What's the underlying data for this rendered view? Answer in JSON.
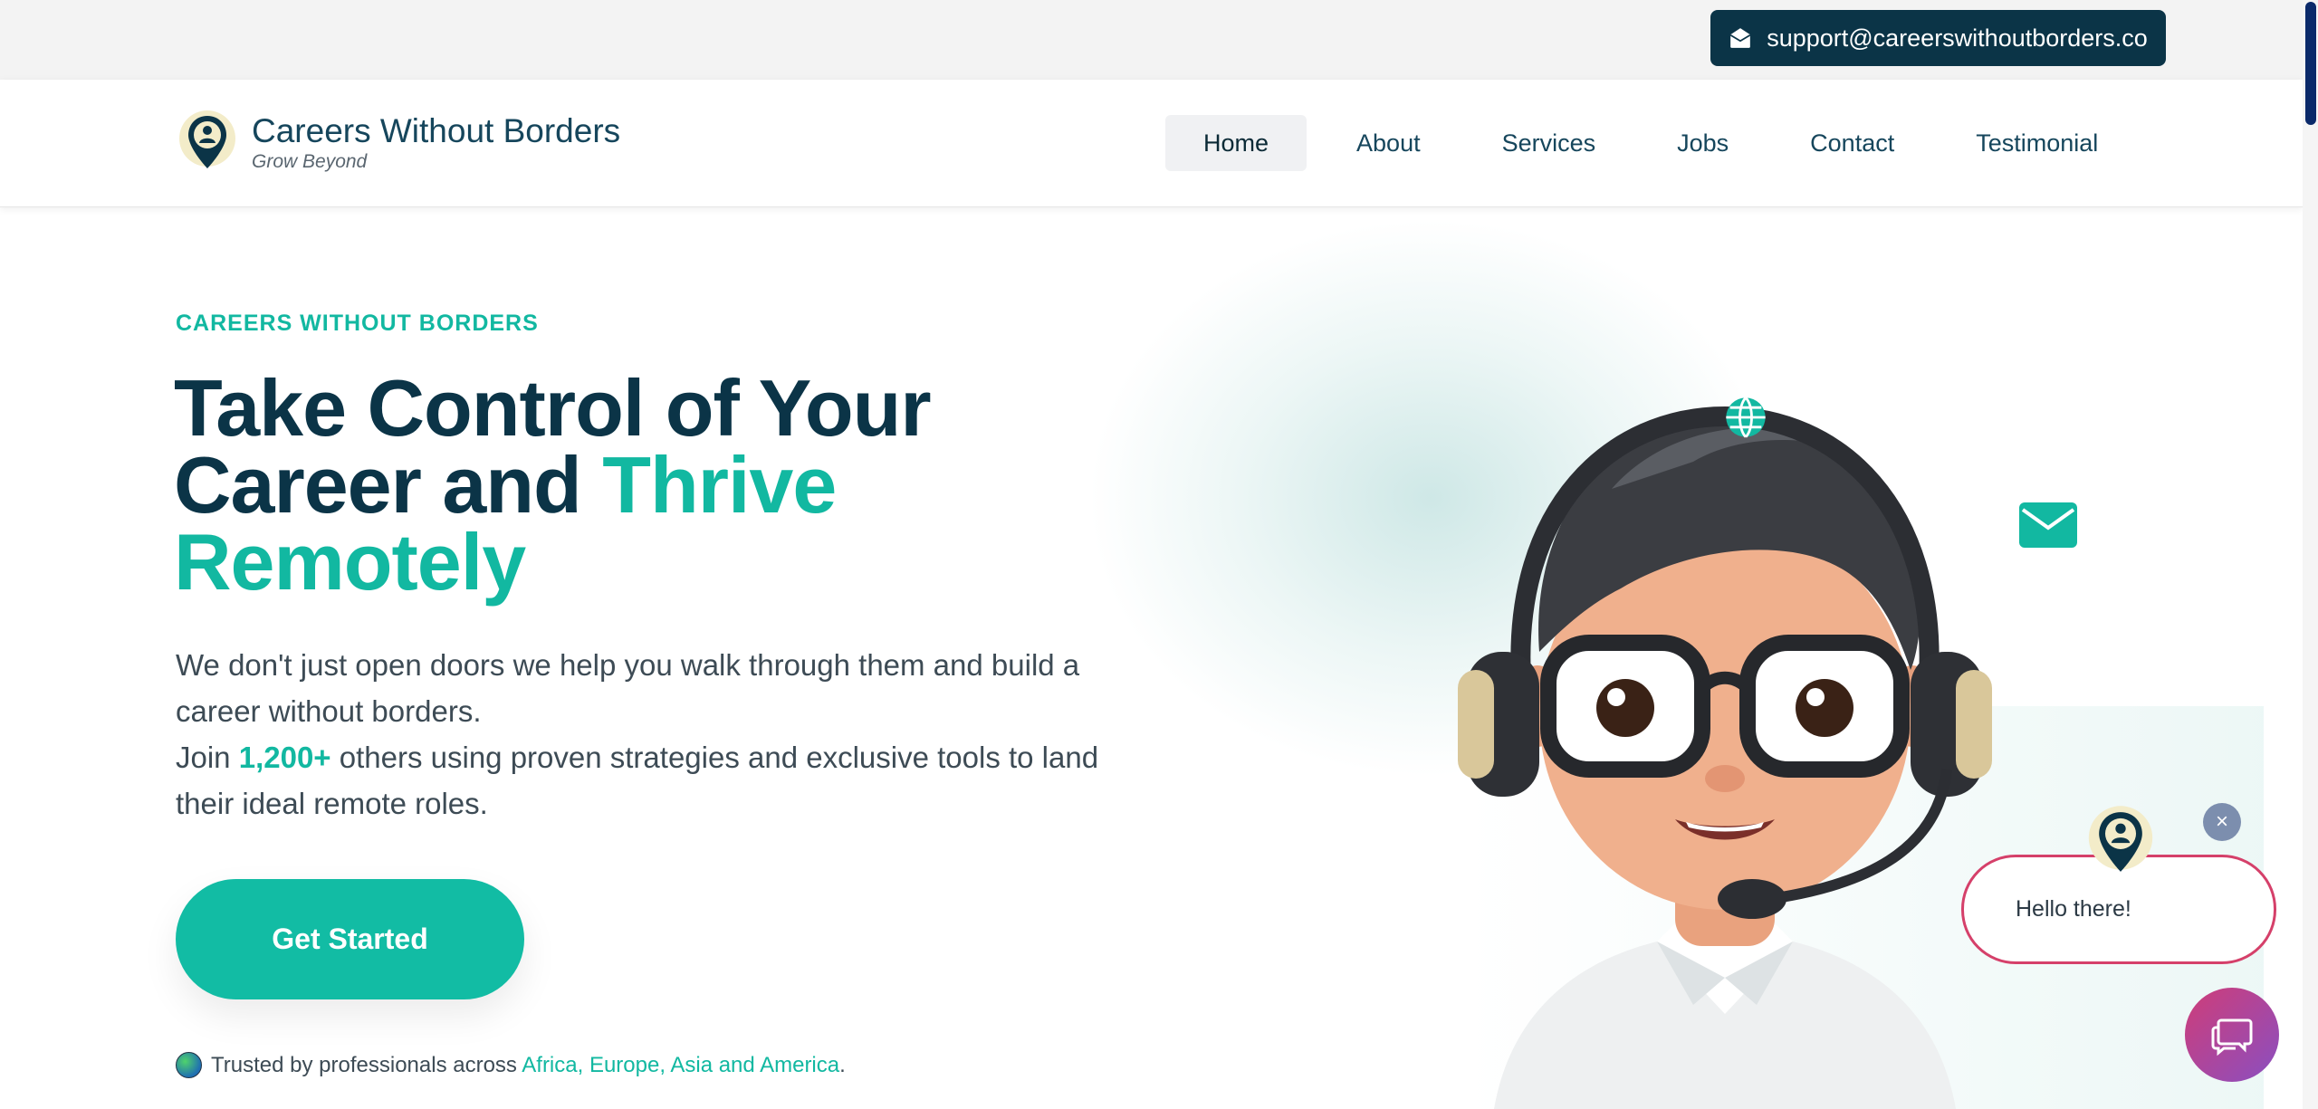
{
  "topbar": {
    "email": "support@careerswithoutborders.co",
    "email_icon": "envelope-open-icon"
  },
  "brand": {
    "name": "Careers Without Borders",
    "tagline": "Grow Beyond",
    "logo_icon": "location-pin-person-icon"
  },
  "nav": {
    "active": "Home",
    "items": [
      {
        "label": "Home"
      },
      {
        "label": "About"
      },
      {
        "label": "Services"
      },
      {
        "label": "Jobs"
      },
      {
        "label": "Contact"
      },
      {
        "label": "Testimonial"
      }
    ]
  },
  "hero": {
    "eyebrow": "CAREERS WITHOUT BORDERS",
    "title_part1": "Take Control of Your Career and ",
    "title_accent": "Thrive Remotely",
    "desc_line1": "We don't just open doors we help you walk through them and build a career without borders.",
    "desc_join_pre": "Join ",
    "desc_join_count": "1,200+",
    "desc_join_post": " others using proven strategies and exclusive tools to land their ideal remote roles.",
    "cta": "Get Started",
    "trust_pre": "Trusted by professionals across ",
    "trust_regions": "Africa, Europe, Asia and America",
    "trust_post": "."
  },
  "illustration": {
    "character": "support-agent-headset-avatar",
    "icons": [
      "globe-icon",
      "mail-icon"
    ]
  },
  "chat": {
    "greeting": "Hello there!",
    "close_label": "×",
    "launcher_icon": "chat-bubbles-icon"
  },
  "colors": {
    "navy": "#0b3447",
    "teal": "#12b8a1",
    "chat_pink": "#d5406a",
    "chat_purple": "#8a4fc1"
  }
}
